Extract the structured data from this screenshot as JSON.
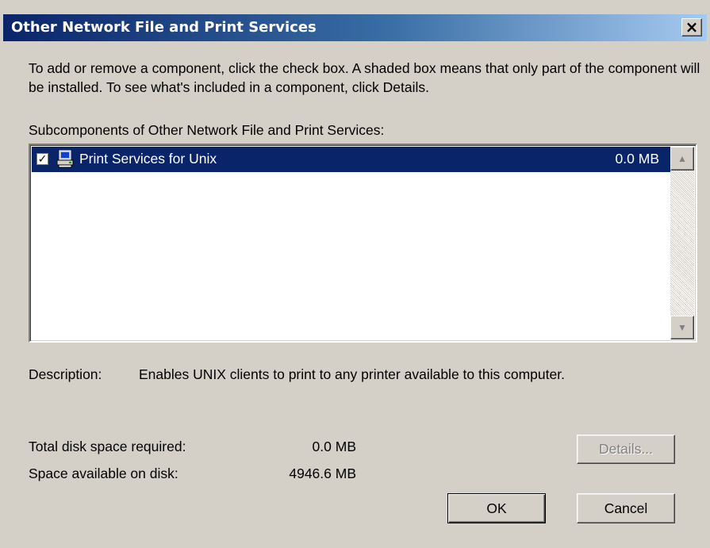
{
  "dialog": {
    "title": "Other Network File and Print Services",
    "close_glyph": "×",
    "instructions": "To add or remove a component, click the check box. A shaded box means that only part of the component will be installed. To see what's included in a component, click Details.",
    "subcomponents_label": "Subcomponents of Other Network File and Print Services:",
    "components": [
      {
        "label": "Print Services for Unix",
        "size": "0.0 MB",
        "checked": true,
        "selected": true,
        "icon": "printer-computer-icon"
      }
    ],
    "description_label": "Description:",
    "description_text": "Enables UNIX clients to print to any printer available to this computer.",
    "disk": {
      "required_label": "Total disk space required:",
      "required_value": "0.0 MB",
      "available_label": "Space available on disk:",
      "available_value": "4946.6 MB"
    },
    "buttons": {
      "details": "Details...",
      "ok": "OK",
      "cancel": "Cancel"
    },
    "colors": {
      "selection": "#0a246a",
      "face": "#d4d0c8"
    }
  }
}
